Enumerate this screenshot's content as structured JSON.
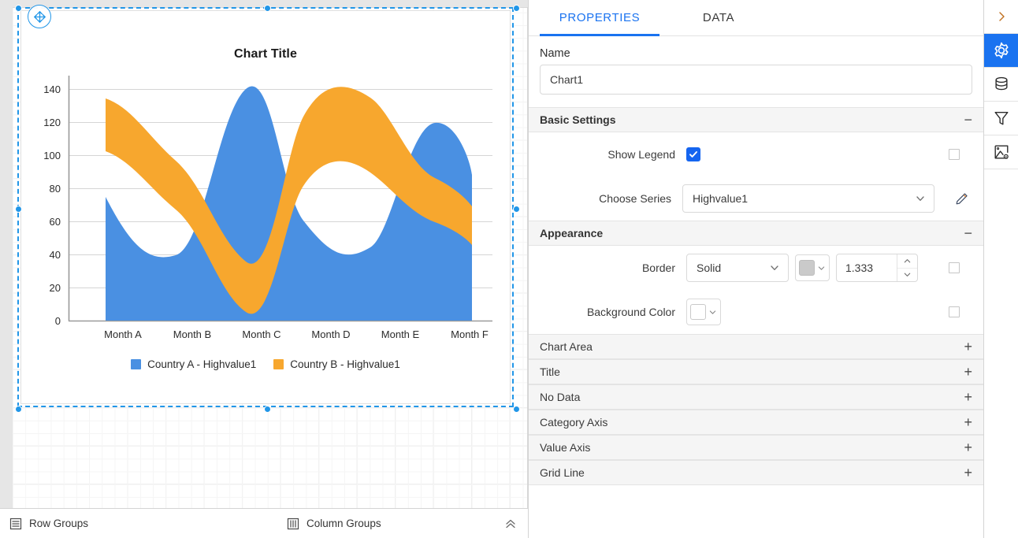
{
  "canvas": {
    "chart": {
      "title": "Chart Title",
      "legend": [
        {
          "label": "Country A - Highvalue1",
          "color": "#4a90e2"
        },
        {
          "label": "Country B - Highvalue1",
          "color": "#f7a72e"
        }
      ]
    },
    "move_handle_icon": "move-cross-icon"
  },
  "chart_data": {
    "type": "area",
    "title": "Chart Title",
    "xlabel": "",
    "ylabel": "",
    "categories": [
      "Month A",
      "Month B",
      "Month C",
      "Month D",
      "Month E",
      "Month F"
    ],
    "ylim": [
      0,
      140
    ],
    "yticks": [
      0,
      20,
      40,
      60,
      80,
      100,
      120,
      140
    ],
    "grid": true,
    "legend_position": "bottom",
    "series": [
      {
        "name": "Country A - Highvalue1",
        "color": "#4a90e2",
        "values": [
          75,
          35,
          142,
          50,
          33,
          107,
          78
        ]
      },
      {
        "name": "Country B - Highvalue1",
        "color": "#f7a72e",
        "values": [
          135,
          96,
          48,
          135,
          108,
          95,
          58
        ]
      }
    ],
    "note": "Spline range/area chart; blue series rendered behind orange band"
  },
  "groups_bar": {
    "row_groups": "Row Groups",
    "column_groups": "Column Groups",
    "row_icon": "rows-icon",
    "column_icon": "columns-icon",
    "collapse_icon": "double-chevron-up-icon"
  },
  "properties": {
    "tabs": [
      {
        "id": "properties",
        "label": "PROPERTIES",
        "active": true
      },
      {
        "id": "data",
        "label": "DATA",
        "active": false
      }
    ],
    "name_section": {
      "label": "Name",
      "value": "Chart1",
      "placeholder": "Name"
    },
    "basic_settings": {
      "title": "Basic Settings",
      "toggle": "−",
      "show_legend": {
        "label": "Show Legend",
        "checked": true
      },
      "choose_series": {
        "label": "Choose Series",
        "value": "Highvalue1",
        "edit_icon": "pencil-icon"
      }
    },
    "appearance": {
      "title": "Appearance",
      "toggle": "−",
      "border": {
        "label": "Border",
        "style": "Solid",
        "color": "#cacaca",
        "width": "1.333"
      },
      "background_color": {
        "label": "Background Color",
        "color": "#ffffff"
      }
    },
    "collapsed_sections": [
      {
        "label": "Chart Area",
        "toggle": "+"
      },
      {
        "label": "Title",
        "toggle": "+"
      },
      {
        "label": "No Data",
        "toggle": "+"
      },
      {
        "label": "Category Axis",
        "toggle": "+"
      },
      {
        "label": "Value Axis",
        "toggle": "+"
      },
      {
        "label": "Grid Line",
        "toggle": "+"
      }
    ]
  },
  "rail": {
    "items": [
      {
        "id": "expand",
        "icon": "chevron-right-icon",
        "active": false
      },
      {
        "id": "settings",
        "icon": "gear-icon",
        "active": true
      },
      {
        "id": "data-source",
        "icon": "database-icon",
        "active": false
      },
      {
        "id": "filter",
        "icon": "funnel-icon",
        "active": false
      },
      {
        "id": "image-settings",
        "icon": "image-settings-icon",
        "active": false
      }
    ]
  },
  "colors": {
    "accent": "#1a73f0",
    "series_blue": "#4a90e2",
    "series_orange": "#f7a72e",
    "selection": "#2196e8"
  }
}
